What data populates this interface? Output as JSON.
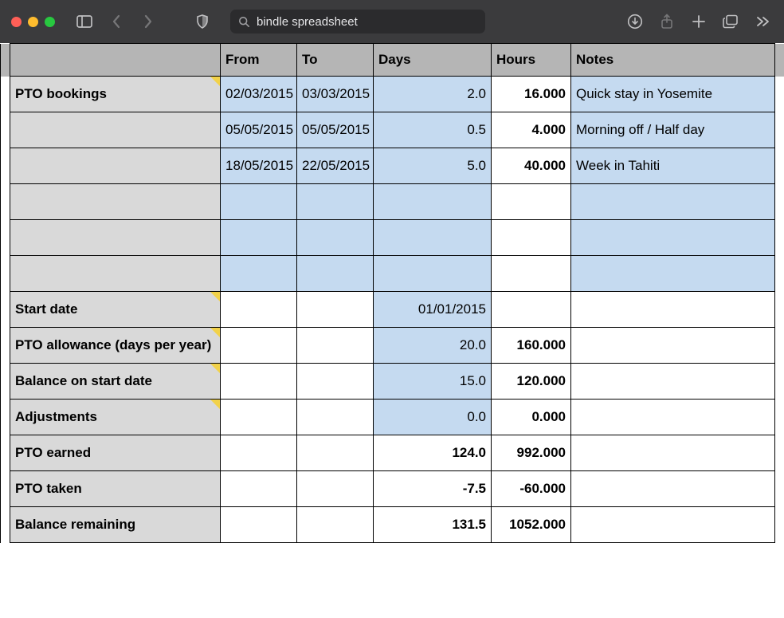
{
  "toolbar": {
    "search_value": "bindle spreadsheet"
  },
  "sheet": {
    "headers": {
      "label": "",
      "from": "From",
      "to": "To",
      "days": "Days",
      "hours": "Hours",
      "notes": "Notes"
    },
    "bookings_section_label": "PTO bookings",
    "bookings": [
      {
        "from": "02/03/2015",
        "to": "03/03/2015",
        "days": "2.0",
        "hours": "16.000",
        "notes": "Quick stay in Yosemite"
      },
      {
        "from": "05/05/2015",
        "to": "05/05/2015",
        "days": "0.5",
        "hours": "4.000",
        "notes": "Morning off / Half day"
      },
      {
        "from": "18/05/2015",
        "to": "22/05/2015",
        "days": "5.0",
        "hours": "40.000",
        "notes": "Week in Tahiti"
      }
    ],
    "summary": [
      {
        "label": "Start date",
        "days": "01/01/2015",
        "hours": "",
        "days_is_blue": true,
        "label_has_comment": true
      },
      {
        "label": "PTO allowance (days per year)",
        "days": "20.0",
        "hours": "160.000",
        "days_is_blue": true,
        "label_has_comment": true
      },
      {
        "label": "Balance on start date",
        "days": "15.0",
        "hours": "120.000",
        "days_is_blue": true,
        "label_has_comment": true
      },
      {
        "label": "Adjustments",
        "days": "0.0",
        "hours": "0.000",
        "days_is_blue": true,
        "label_has_comment": true
      },
      {
        "label": "PTO earned",
        "days": "124.0",
        "hours": "992.000",
        "days_is_blue": false,
        "label_has_comment": false
      },
      {
        "label": "PTO taken",
        "days": "-7.5",
        "hours": "-60.000",
        "days_is_blue": false,
        "label_has_comment": false
      },
      {
        "label": "Balance remaining",
        "days": "131.5",
        "hours": "1052.000",
        "days_is_blue": false,
        "label_has_comment": false
      }
    ]
  }
}
